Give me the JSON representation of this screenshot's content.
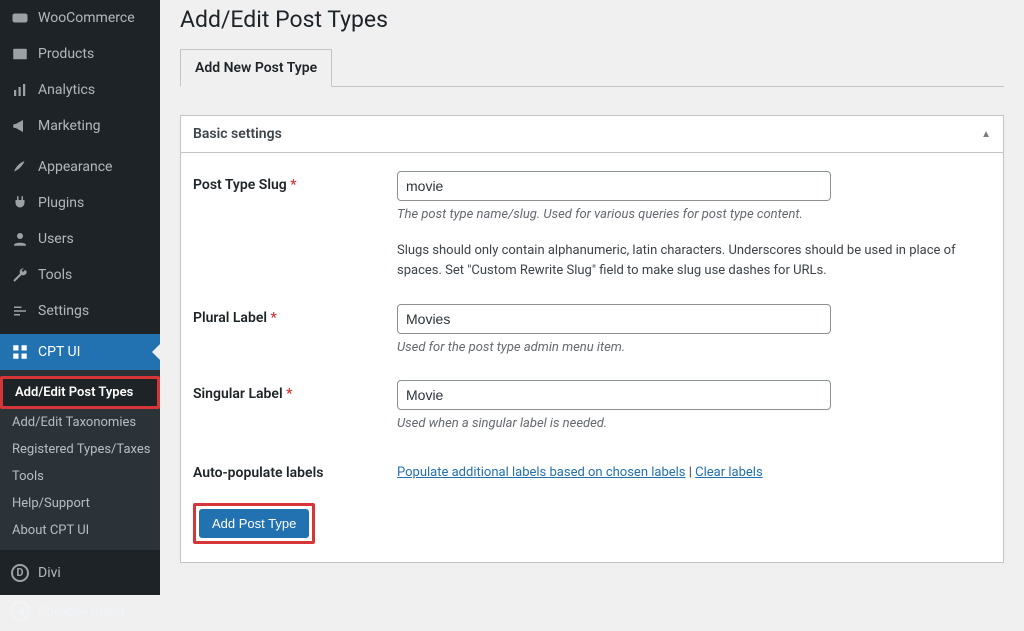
{
  "sidebar": {
    "items": [
      {
        "label": "WooCommerce"
      },
      {
        "label": "Products"
      },
      {
        "label": "Analytics"
      },
      {
        "label": "Marketing"
      },
      {
        "label": "Appearance"
      },
      {
        "label": "Plugins"
      },
      {
        "label": "Users"
      },
      {
        "label": "Tools"
      },
      {
        "label": "Settings"
      },
      {
        "label": "CPT UI"
      }
    ],
    "submenu": [
      {
        "label": "Add/Edit Post Types"
      },
      {
        "label": "Add/Edit Taxonomies"
      },
      {
        "label": "Registered Types/Taxes"
      },
      {
        "label": "Tools"
      },
      {
        "label": "Help/Support"
      },
      {
        "label": "About CPT UI"
      }
    ],
    "divi": "Divi",
    "collapse": "Collapse menu"
  },
  "page": {
    "title": "Add/Edit Post Types",
    "tab_label": "Add New Post Type",
    "section_title": "Basic settings",
    "fields": {
      "slug": {
        "label": "Post Type Slug",
        "value": "movie",
        "desc1": "The post type name/slug. Used for various queries for post type content.",
        "desc2": "Slugs should only contain alphanumeric, latin characters. Underscores should be used in place of spaces. Set \"Custom Rewrite Slug\" field to make slug use dashes for URLs."
      },
      "plural": {
        "label": "Plural Label",
        "value": "Movies",
        "desc": "Used for the post type admin menu item."
      },
      "singular": {
        "label": "Singular Label",
        "value": "Movie",
        "desc": "Used when a singular label is needed."
      },
      "autopop": {
        "label": "Auto-populate labels",
        "link1": "Populate additional labels based on chosen labels",
        "link2": "Clear labels"
      }
    },
    "submit_label": "Add Post Type"
  }
}
